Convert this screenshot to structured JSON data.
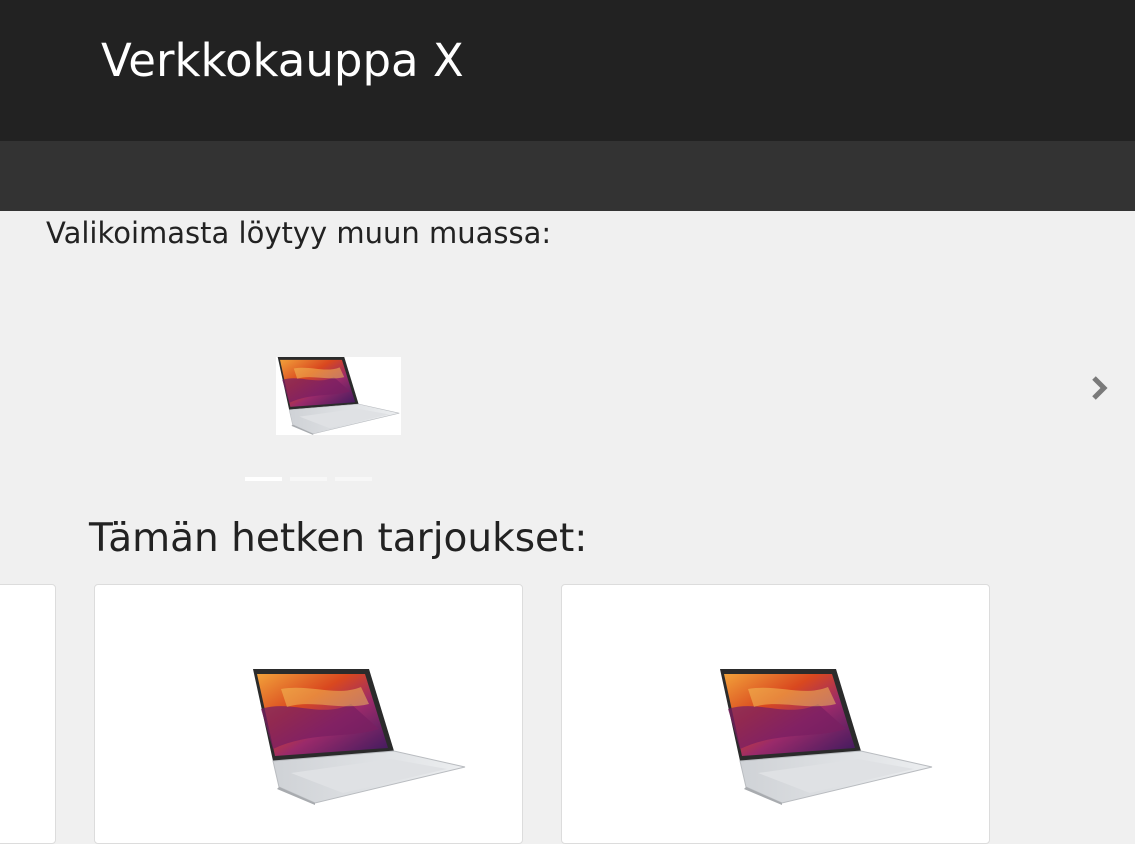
{
  "header": {
    "site_title": "Verkkokauppa X"
  },
  "selection": {
    "heading": "Valikoimasta löytyy muun muassa:",
    "carousel": {
      "slides": [
        {
          "image": "laptop-image"
        },
        {
          "image": "laptop-image"
        },
        {
          "image": "laptop-image"
        }
      ],
      "active_index": 0,
      "next_icon": "chevron-right-icon"
    }
  },
  "offers": {
    "heading": "Tämän hetken tarjoukset:",
    "cards": [
      {
        "image": "laptop-image"
      },
      {
        "image": "laptop-image"
      },
      {
        "image": "laptop-image"
      }
    ]
  },
  "colors": {
    "header_bg": "#222222",
    "navbar_bg": "#333333",
    "page_bg": "#f0f0f0"
  }
}
